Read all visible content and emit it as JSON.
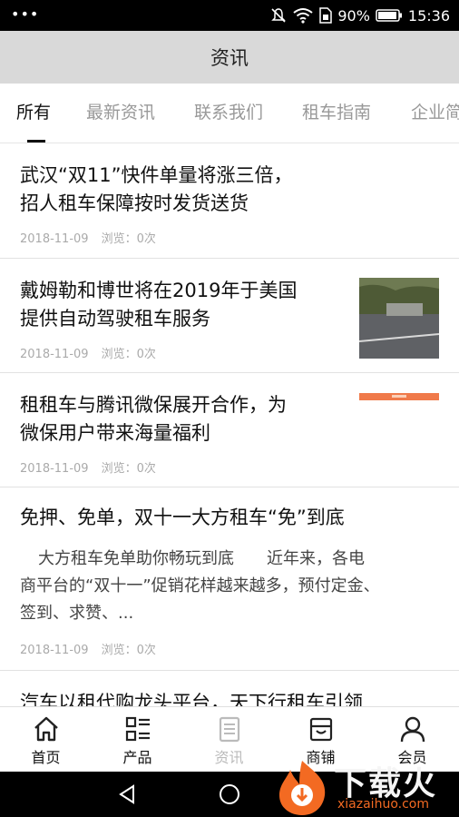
{
  "status_bar": {
    "battery_percent": "90%",
    "time": "15:36"
  },
  "header": {
    "title": "资讯"
  },
  "tabs": [
    {
      "label": "所有",
      "active": true
    },
    {
      "label": "最新资讯",
      "active": false
    },
    {
      "label": "联系我们",
      "active": false
    },
    {
      "label": "租车指南",
      "active": false
    },
    {
      "label": "企业简",
      "active": false
    }
  ],
  "news": [
    {
      "title_lines": [
        "武汉“双11”快件单量将涨三倍，",
        "招人租车保障按时发货送货"
      ],
      "date": "2018-11-09",
      "views": "浏览：0次"
    },
    {
      "title_lines": [
        "戴姆勒和博世将在2019年于美国",
        "提供自动驾驶租车服务"
      ],
      "date": "2018-11-09",
      "views": "浏览：0次",
      "thumbnail": "street-car-photo"
    },
    {
      "title_lines": [
        "租租车与腾讯微保展开合作，为",
        "微保用户带来海量福利"
      ],
      "date": "2018-11-09",
      "views": "浏览：0次",
      "thumbnail": "orange-banner"
    },
    {
      "title_lines": [
        "免押、免单，双十一大方租车“免”到底"
      ],
      "excerpt_lines": [
        "大方租车免单助你畅玩到底　　近年来，各电",
        "商平台的“双十一”促销花样越来越多，预付定金、",
        "签到、求赞、..."
      ],
      "date": "2018-11-09",
      "views": "浏览：0次"
    },
    {
      "title_lines": [
        "汽车以租代购龙头平台，天下行租车引领"
      ]
    }
  ],
  "bottom_nav": [
    {
      "label": "首页",
      "icon": "home-icon",
      "enabled": true
    },
    {
      "label": "产品",
      "icon": "grid-list-icon",
      "enabled": true
    },
    {
      "label": "资讯",
      "icon": "news-icon",
      "enabled": false
    },
    {
      "label": "商铺",
      "icon": "shop-icon",
      "enabled": true
    },
    {
      "label": "会员",
      "icon": "user-icon",
      "enabled": true
    }
  ],
  "watermark": {
    "text": "下载火",
    "url": "xiazaihuo.com"
  }
}
